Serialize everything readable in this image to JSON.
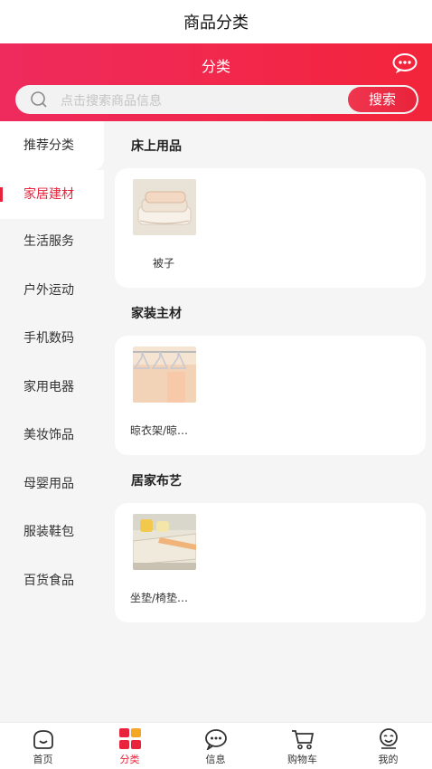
{
  "header": {
    "title": "商品分类"
  },
  "banner": {
    "subtitle": "分类"
  },
  "search": {
    "placeholder": "点击搜索商品信息",
    "button": "搜索"
  },
  "sidebar": {
    "items": [
      {
        "label": "推荐分类"
      },
      {
        "label": "家居建材",
        "active": true
      },
      {
        "label": "生活服务"
      },
      {
        "label": "户外运动"
      },
      {
        "label": "手机数码"
      },
      {
        "label": "家用电器"
      },
      {
        "label": "美妆饰品"
      },
      {
        "label": "母婴用品"
      },
      {
        "label": "服装鞋包"
      },
      {
        "label": "百货食品"
      }
    ]
  },
  "sections": [
    {
      "title": "床上用品",
      "products": [
        {
          "name": "被子",
          "icon": "quilt-image"
        }
      ]
    },
    {
      "title": "家装主材",
      "products": [
        {
          "name": "晾衣架/晾…",
          "icon": "hanger-image"
        }
      ]
    },
    {
      "title": "居家布艺",
      "products": [
        {
          "name": "坐垫/椅垫…",
          "icon": "cushion-image"
        }
      ]
    }
  ],
  "tabbar": {
    "tabs": [
      {
        "label": "首页",
        "icon": "home-icon"
      },
      {
        "label": "分类",
        "icon": "category-icon",
        "active": true
      },
      {
        "label": "信息",
        "icon": "message-icon"
      },
      {
        "label": "购物车",
        "icon": "cart-icon"
      },
      {
        "label": "我的",
        "icon": "profile-icon"
      }
    ]
  },
  "colors": {
    "accent": "#e8233b",
    "header_gradient_start": "#ee2b5d",
    "header_gradient_end": "#f3253a",
    "background": "#f5f5f5"
  }
}
